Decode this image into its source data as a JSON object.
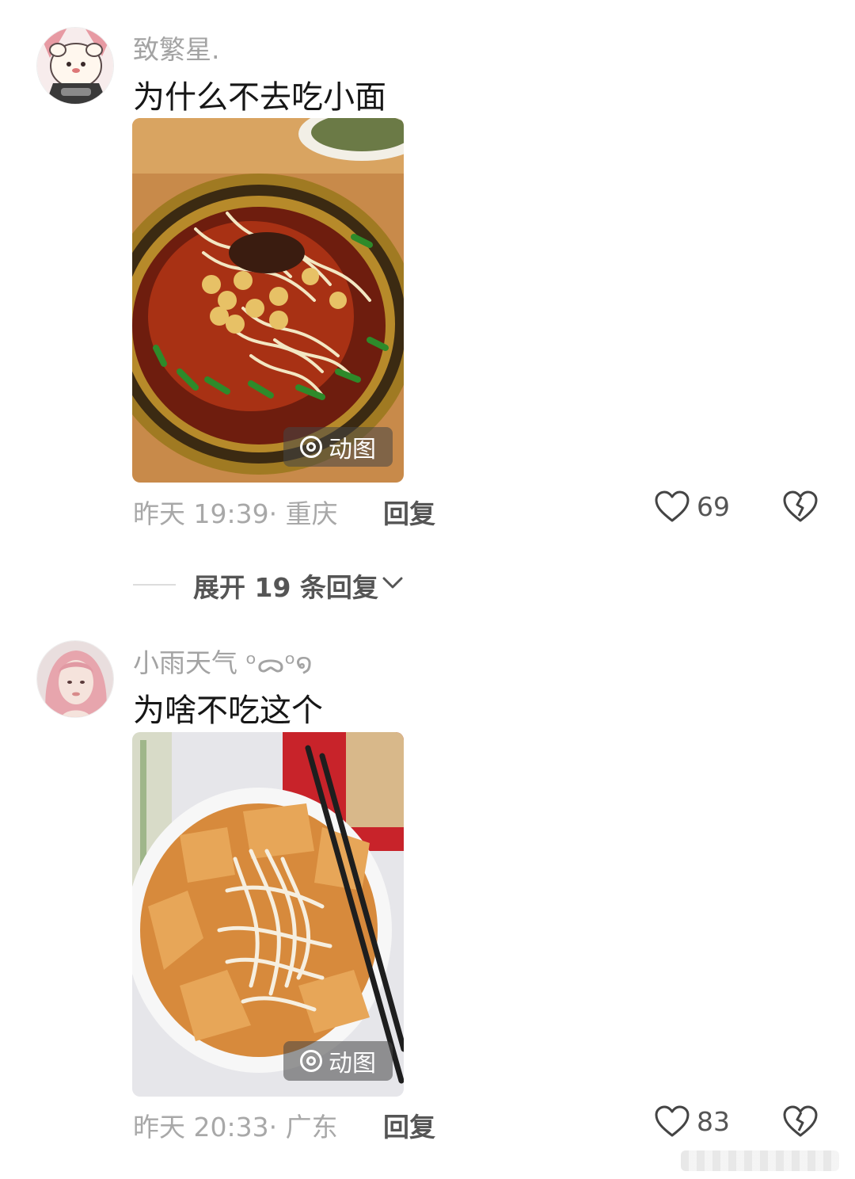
{
  "comments": [
    {
      "username": "致繁星.",
      "text": "为什么不去吃小面",
      "media_badge": "动图",
      "time_location": "昨天 19:39· 重庆",
      "reply_label": "回复",
      "like_count": "69",
      "icons": [
        "animated-image-icon",
        "heart-icon",
        "broken-heart-icon"
      ]
    },
    {
      "username": "小雨天气 ᵒᯅᵒ໑",
      "text": "为啥不吃这个",
      "media_badge": "动图",
      "time_location": "昨天 20:33· 广东",
      "reply_label": "回复",
      "like_count": "83",
      "icons": [
        "animated-image-icon",
        "heart-icon",
        "broken-heart-icon"
      ]
    }
  ],
  "expand_replies": {
    "label": "展开 19 条回复",
    "icon": "chevron-down-icon"
  }
}
